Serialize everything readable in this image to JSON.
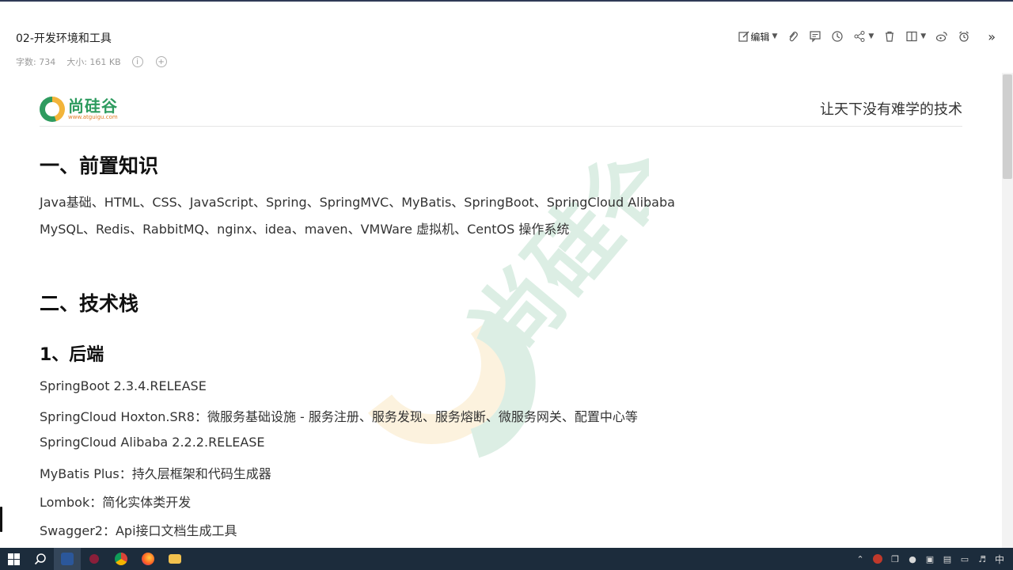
{
  "doc": {
    "title": "02-开发环境和工具",
    "word_count": "字数: 734",
    "size": "大小: 161 KB",
    "info_icon": "info-icon",
    "add_icon": "plus-icon"
  },
  "toolbar": {
    "edit_label": "编辑",
    "more_label": "»",
    "icons": [
      "edit-icon",
      "attachment-icon",
      "comment-icon",
      "history-icon",
      "share-icon",
      "delete-icon",
      "layout-icon",
      "weibo-icon",
      "alarm-icon"
    ]
  },
  "header": {
    "logo_cn": "尚硅谷",
    "logo_url": "www.atguigu.com",
    "slogan": "让天下没有难学的技术"
  },
  "content": {
    "section1_title": "一、前置知识",
    "section1_line1": "Java基础、HTML、CSS、JavaScript、Spring、SpringMVC、MyBatis、SpringBoot、SpringCloud Alibaba",
    "section1_line2": "MySQL、Redis、RabbitMQ、nginx、idea、maven、VMWare 虚拟机、CentOS 操作系统",
    "section2_title": "二、技术栈",
    "sub1_title": "1、后端",
    "items": [
      "SpringBoot 2.3.4.RELEASE",
      "SpringCloud Hoxton.SR8：微服务基础设施 - 服务注册、服务发现、服务熔断、微服务网关、配置中心等",
      "SpringCloud Alibaba 2.2.2.RELEASE",
      "MyBatis Plus：持久层框架和代码生成器",
      "Lombok：简化实体类开发",
      "Swagger2：Api接口文档生成工具"
    ]
  },
  "taskbar": {
    "ime": "中",
    "colors": {
      "bg": "#1c2c3c",
      "accent_green": "#2e9b5f",
      "accent_orange": "#f2b43a"
    }
  }
}
